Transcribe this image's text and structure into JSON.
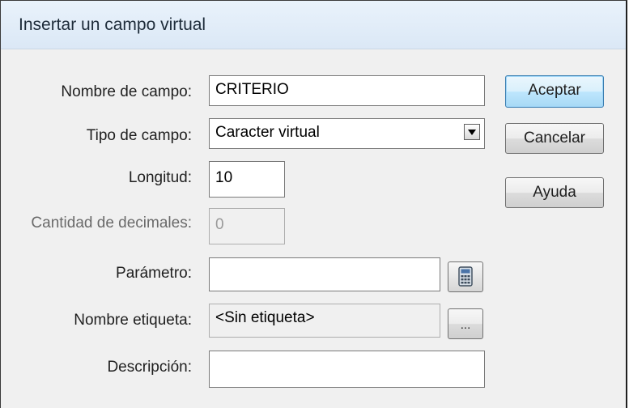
{
  "window": {
    "title": "Insertar un campo virtual"
  },
  "form": {
    "nombre": {
      "label": "Nombre de campo:",
      "value": "CRITERIO"
    },
    "tipo": {
      "label": "Tipo de campo:",
      "value": "Caracter virtual"
    },
    "longitud": {
      "label": "Longitud:",
      "value": "10"
    },
    "decimales": {
      "label": "Cantidad de decimales:",
      "value": "0"
    },
    "parametro": {
      "label": "Parámetro:",
      "value": ""
    },
    "etiqueta": {
      "label": "Nombre etiqueta:",
      "value": "<Sin etiqueta>",
      "browse_label": "..."
    },
    "descripcion": {
      "label": "Descripción:",
      "value": ""
    }
  },
  "buttons": {
    "accept": "Aceptar",
    "cancel": "Cancelar",
    "help": "Ayuda"
  },
  "icons": {
    "calculator": "calculator-icon",
    "dropdown": "chevron-down-icon"
  }
}
